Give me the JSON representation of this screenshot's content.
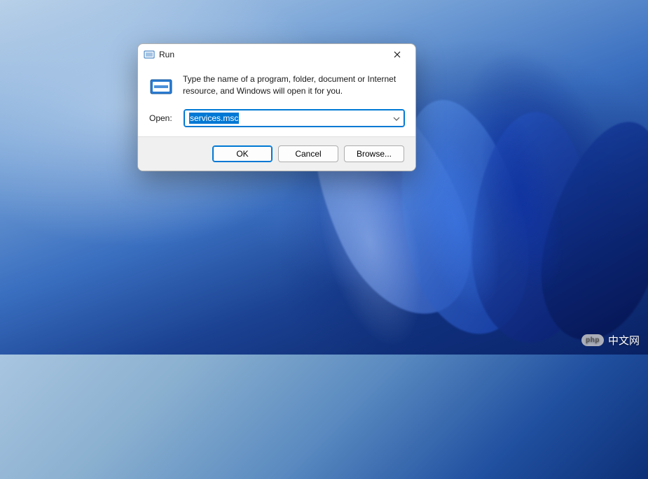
{
  "dialog": {
    "title": "Run",
    "description": "Type the name of a program, folder, document or Internet resource, and Windows will open it for you.",
    "open_label": "Open:",
    "input_value": "services.msc",
    "buttons": {
      "ok": "OK",
      "cancel": "Cancel",
      "browse": "Browse..."
    }
  },
  "watermark": {
    "badge": "php",
    "text": "中文网"
  }
}
